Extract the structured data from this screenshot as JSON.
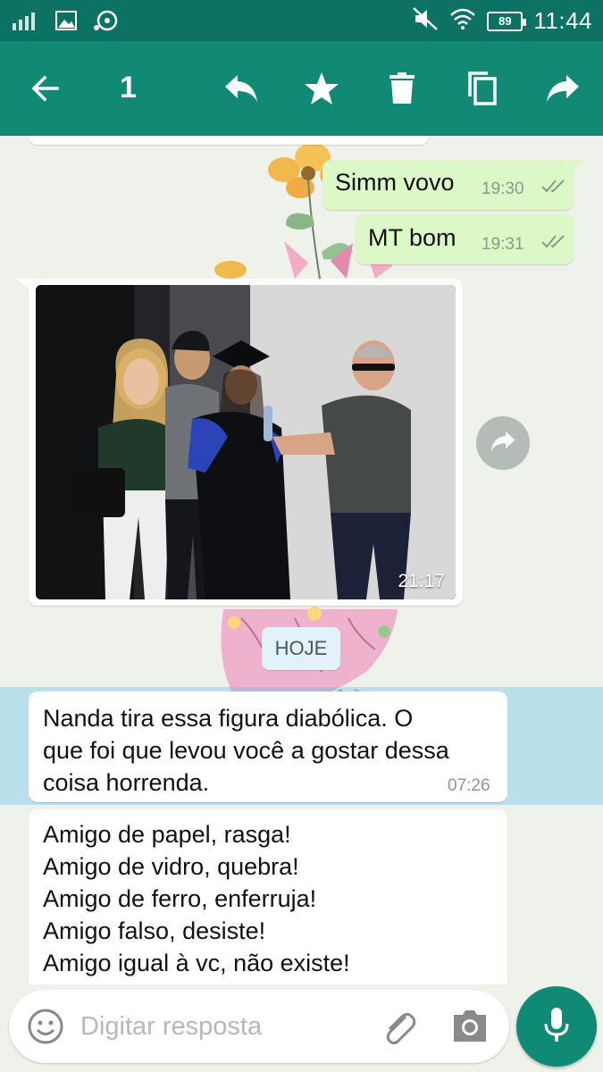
{
  "status_bar": {
    "time": "11:44",
    "battery": "89"
  },
  "action_bar": {
    "selected_count": "1",
    "icons": [
      "back-arrow-icon",
      "reply-icon",
      "star-icon",
      "delete-icon",
      "copy-icon",
      "forward-icon"
    ]
  },
  "messages": [
    {
      "direction": "out",
      "text": "Simm vovo",
      "time": "19:30"
    },
    {
      "direction": "out",
      "text": "MT bom",
      "time": "19:31"
    },
    {
      "direction": "in",
      "type": "image",
      "time": "21:17"
    },
    {
      "direction": "in",
      "text_lines": [
        "Nanda tira essa figura diabólica. O",
        "que foi que levou você a gostar dessa",
        "coisa horrenda."
      ],
      "time": "07:26",
      "selected": true
    },
    {
      "direction": "in",
      "text_lines": [
        "Amigo de papel, rasga!",
        "Amigo de vidro, quebra!",
        "Amigo de ferro, enferruja!",
        "Amigo falso, desiste!",
        "Amigo igual à vc, não existe!"
      ]
    }
  ],
  "date_divider": "HOJE",
  "input": {
    "placeholder": "Digitar resposta"
  },
  "colors": {
    "status_bar": "#0b7264",
    "action_bar": "#108a75",
    "outgoing_bubble": "#dcf8c6",
    "incoming_bubble": "#ffffff",
    "selection_highlight": "#34b7f1",
    "mic_button": "#0f8a74"
  }
}
